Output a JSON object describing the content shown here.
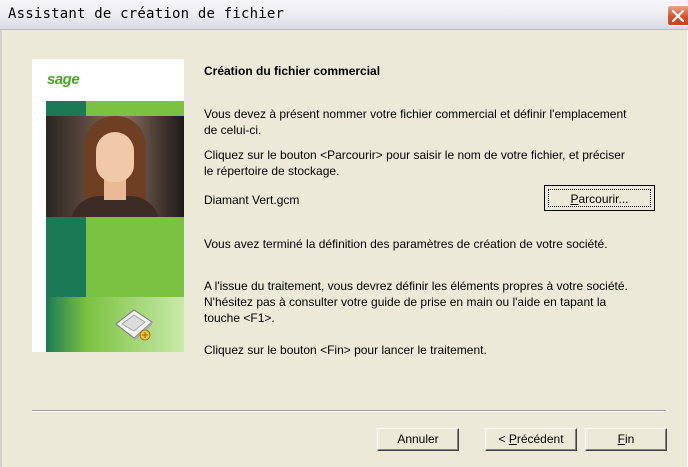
{
  "window": {
    "title": "Assistant de création de fichier",
    "close_icon": "close-icon",
    "close_color": "#d7522f"
  },
  "sidebar": {
    "logo_text": "sage",
    "colors": {
      "dark_green": "#1b7a55",
      "light_green": "#7cc242"
    },
    "icon": "disk-icon"
  },
  "content": {
    "heading": "Création du fichier commercial",
    "para1_line1": "Vous devez à présent nommer votre fichier commercial et définir l'emplacement",
    "para1_line2": "de celui-ci.",
    "para2_line1": "Cliquez sur le bouton <Parcourir> pour saisir le nom de votre fichier, et préciser",
    "para2_line2": "le répertoire de stockage.",
    "filename": "Diamant Vert.gcm",
    "para3": "Vous avez terminé la définition des paramètres de création de votre société.",
    "para4_line1": "A l'issue du traitement, vous devrez définir les éléments propres à votre société.",
    "para4_line2": "N'hésitez pas à consulter votre guide de prise en main ou l'aide en tapant la",
    "para4_line3": "touche <F1>.",
    "para5": "Cliquez sur le bouton <Fin> pour lancer le traitement."
  },
  "buttons": {
    "parcourir": {
      "accel": "P",
      "rest": "arcourir..."
    },
    "annuler": "Annuler",
    "precedent": {
      "prefix": "< ",
      "accel": "P",
      "rest": "récédent"
    },
    "fin": {
      "accel": "F",
      "rest": "in"
    }
  }
}
